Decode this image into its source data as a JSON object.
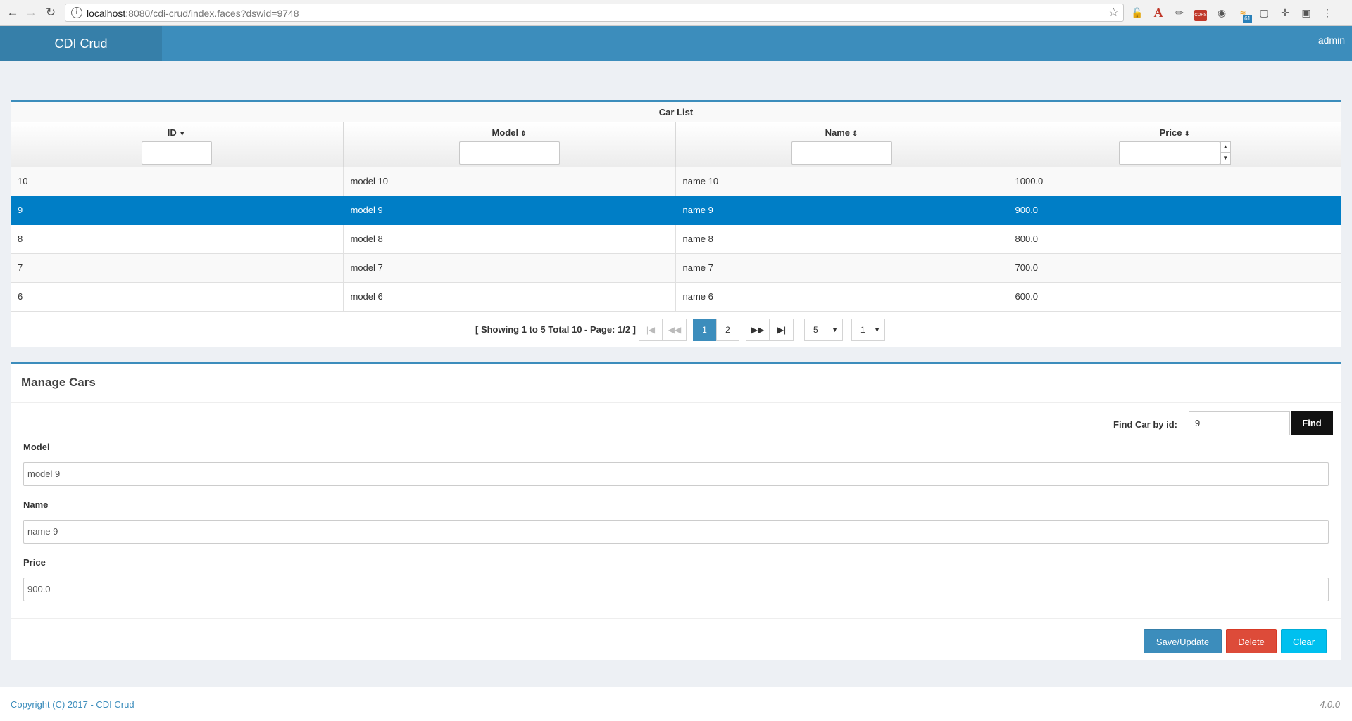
{
  "browser": {
    "url_host": "localhost",
    "url_rest": ":8080/cdi-crud/index.faces?dswid=9748",
    "ext_badge": "61",
    "ext_cors": "CORS"
  },
  "header": {
    "brand": "CDI Crud",
    "user": "admin"
  },
  "car_list": {
    "caption": "Car List",
    "columns": [
      "ID",
      "Model",
      "Name",
      "Price"
    ],
    "rows": [
      {
        "id": "10",
        "model": "model 10",
        "name": "name 10",
        "price": "1000.0"
      },
      {
        "id": "9",
        "model": "model 9",
        "name": "name 9",
        "price": "900.0"
      },
      {
        "id": "8",
        "model": "model 8",
        "name": "name 8",
        "price": "800.0"
      },
      {
        "id": "7",
        "model": "model 7",
        "name": "name 7",
        "price": "700.0"
      },
      {
        "id": "6",
        "model": "model 6",
        "name": "name 6",
        "price": "600.0"
      }
    ],
    "selected_index": 1,
    "pager": {
      "info": "[ Showing 1 to 5 Total 10 - Page: 1/2 ]",
      "pages": [
        "1",
        "2"
      ],
      "active_page": "1",
      "rows_per_page": "5",
      "jump_page": "1"
    }
  },
  "manage": {
    "title": "Manage Cars",
    "find_label": "Find Car by id:",
    "find_value": "9",
    "find_button": "Find",
    "model_label": "Model",
    "model_value": "model 9",
    "name_label": "Name",
    "name_value": "name 9",
    "price_label": "Price",
    "price_value": "900.0",
    "save_button": "Save/Update",
    "delete_button": "Delete",
    "clear_button": "Clear"
  },
  "footer": {
    "copyright": "Copyright (C) 2017 - CDI Crud",
    "version": "4.0.0"
  },
  "colors": {
    "primary": "#3c8dbc",
    "selected_row": "#007ec6",
    "danger": "#dd4b39",
    "info": "#00c0ef"
  }
}
